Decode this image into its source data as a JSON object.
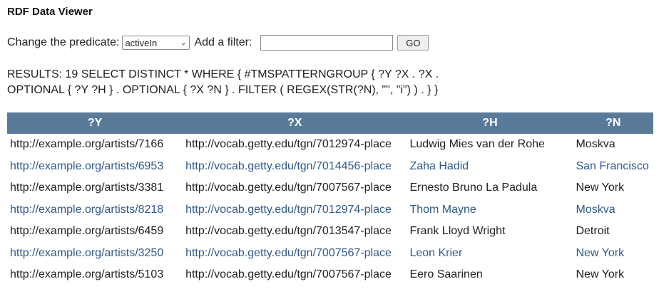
{
  "app": {
    "title": "RDF Data Viewer"
  },
  "controls": {
    "predicate_label": "Change the predicate:",
    "predicate_selected": "activeIn",
    "filter_label": "Add a filter:",
    "filter_value": "",
    "go_label": "GO"
  },
  "results": {
    "line1": "RESULTS: 19 SELECT DISTINCT * WHERE { #TMSPATTERNGROUP { ?Y ?X . ?X .",
    "line2": "OPTIONAL { ?Y ?H } . OPTIONAL { ?X ?N } . FILTER ( REGEX(STR(?N), \"\", \"i\") ) . } }"
  },
  "table": {
    "headers": [
      "?Y",
      "?X",
      "?H",
      "?N"
    ],
    "rows": [
      [
        "http://example.org/artists/7166",
        "http://vocab.getty.edu/tgn/7012974-place",
        "Ludwig Mies van der Rohe",
        "Moskva"
      ],
      [
        "http://example.org/artists/6953",
        "http://vocab.getty.edu/tgn/7014456-place",
        "Zaha Hadid",
        "San Francisco"
      ],
      [
        "http://example.org/artists/3381",
        "http://vocab.getty.edu/tgn/7007567-place",
        "Ernesto Bruno La Padula",
        "New York"
      ],
      [
        "http://example.org/artists/8218",
        "http://vocab.getty.edu/tgn/7012974-place",
        "Thom Mayne",
        "Moskva"
      ],
      [
        "http://example.org/artists/6459",
        "http://vocab.getty.edu/tgn/7013547-place",
        "Frank Lloyd Wright",
        "Detroit"
      ],
      [
        "http://example.org/artists/3250",
        "http://vocab.getty.edu/tgn/7007567-place",
        "Leon Krier",
        "New York"
      ],
      [
        "http://example.org/artists/5103",
        "http://vocab.getty.edu/tgn/7007567-place",
        "Eero Saarinen",
        "New York"
      ]
    ]
  },
  "colors": {
    "header_bg": "#5a7a9a",
    "link_text": "#2f5a8a"
  },
  "icons": {
    "dropdown": "chevron-down-icon"
  }
}
